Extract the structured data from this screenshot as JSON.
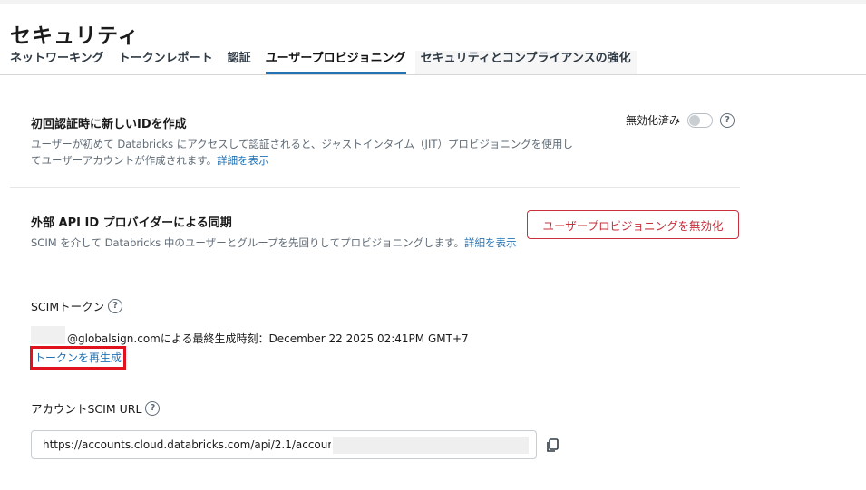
{
  "page": {
    "title": "セキュリティ"
  },
  "tabs": [
    {
      "label": "ネットワーキング"
    },
    {
      "label": "トークンレポート"
    },
    {
      "label": "認証"
    },
    {
      "label": "ユーザープロビジョニング"
    },
    {
      "label": "セキュリティとコンプライアンスの強化"
    }
  ],
  "active_tab": "ユーザープロビジョニング",
  "jit": {
    "title": "初回認証時に新しいIDを作成",
    "description": "ユーザーが初めて Databricks にアクセスして認証されると、ジャストインタイム（JIT）プロビジョニングを使用してユーザーアカウントが作成されます。",
    "learn_more": "詳細を表示",
    "toggle_label": "無効化済み",
    "toggle_state": "off"
  },
  "sync": {
    "title": "外部 API ID プロバイダーによる同期",
    "description": "SCIM を介して Databricks 中のユーザーとグループを先回りしてプロビジョニングします。",
    "learn_more": "詳細を表示",
    "disable_button": "ユーザープロビジョニングを無効化"
  },
  "scim_token": {
    "label": "SCIMトークン",
    "info": "@globalsign.comによる最終生成時刻：December 22 2025 02:41PM GMT+7",
    "regenerate_link": "トークンを再生成"
  },
  "scim_url": {
    "label": "アカウントSCIM URL",
    "value": "https://accounts.cloud.databricks.com/api/2.1/accounts"
  },
  "colors": {
    "accent": "#2272b4",
    "danger": "#c8303b",
    "highlight_box": "#e0121e"
  },
  "icons": {
    "help": "help-icon",
    "copy": "copy-icon"
  }
}
